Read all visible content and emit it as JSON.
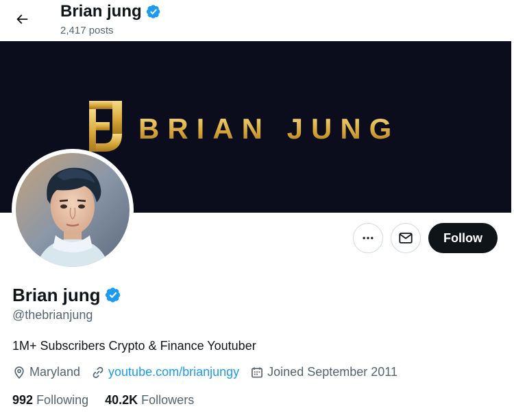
{
  "header": {
    "name": "Brian jung",
    "posts": "2,417 posts"
  },
  "banner": {
    "text": "BRIAN JUNG"
  },
  "actions": {
    "follow_label": "Follow"
  },
  "profile": {
    "name": "Brian jung",
    "handle": "@thebrianjung",
    "bio": "1M+ Subscribers Crypto & Finance Youtuber",
    "location": "Maryland",
    "website": "youtube.com/brianjungy",
    "joined": "Joined September 2011"
  },
  "stats": {
    "following_count": "992",
    "following_label": "Following",
    "followers_count": "40.2K",
    "followers_label": "Followers"
  },
  "colors": {
    "accent": "#1d9bf0",
    "banner_bg": "#0b0d1c",
    "gold": "#d9a83c",
    "follow_bg": "#0f1419"
  },
  "icons": [
    "back-arrow-icon",
    "verified-badge-icon",
    "more-icon",
    "message-icon",
    "location-icon",
    "link-icon",
    "calendar-icon"
  ]
}
